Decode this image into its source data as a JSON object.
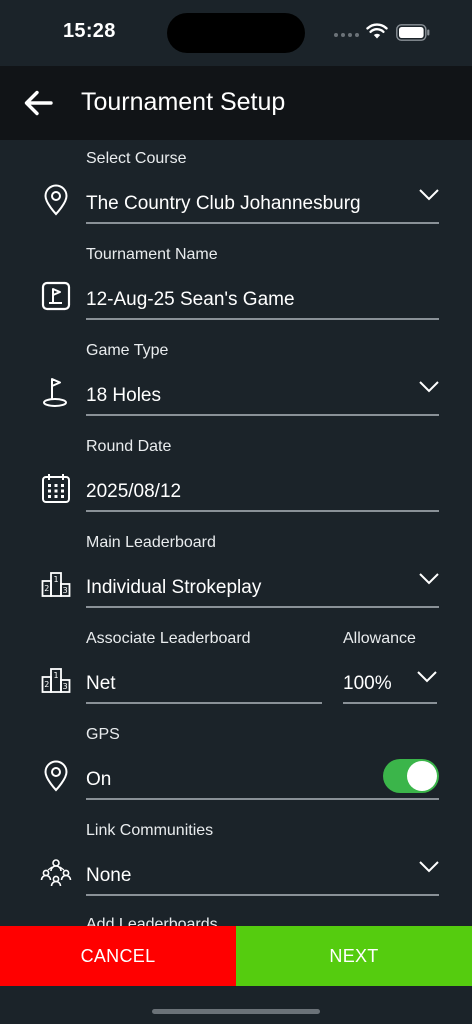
{
  "status_bar": {
    "time": "15:28"
  },
  "header": {
    "title": "Tournament Setup",
    "back_icon": "arrow-left-icon"
  },
  "fields": {
    "course": {
      "label": "Select Course",
      "value": "The Country Club Johannesburg",
      "icon": "location-pin-icon"
    },
    "tournament_name": {
      "label": "Tournament Name",
      "value": "12-Aug-25 Sean's Game",
      "icon": "flag-card-icon"
    },
    "game_type": {
      "label": "Game Type",
      "value": "18 Holes",
      "icon": "golf-flag-icon"
    },
    "round_date": {
      "label": "Round Date",
      "value": "2025/08/12",
      "icon": "calendar-icon"
    },
    "main_leaderboard": {
      "label": "Main Leaderboard",
      "value": "Individual Strokeplay",
      "icon": "podium-icon"
    },
    "associate_leaderboard": {
      "label": "Associate Leaderboard",
      "value": "Net",
      "icon": "podium-icon"
    },
    "allowance": {
      "label": "Allowance",
      "value": "100%"
    },
    "gps": {
      "label": "GPS",
      "value": "On",
      "toggle_on": true,
      "icon": "location-pin-icon"
    },
    "link_communities": {
      "label": "Link Communities",
      "value": "None",
      "icon": "community-icon"
    },
    "add_leaderboards": {
      "label": "Add Leaderboards"
    }
  },
  "footer": {
    "cancel_label": "CANCEL",
    "next_label": "NEXT"
  },
  "colors": {
    "background": "#1b2329",
    "header": "#111417",
    "cancel": "#ff0000",
    "next": "#55cc0f",
    "toggle": "#3bb54a"
  }
}
